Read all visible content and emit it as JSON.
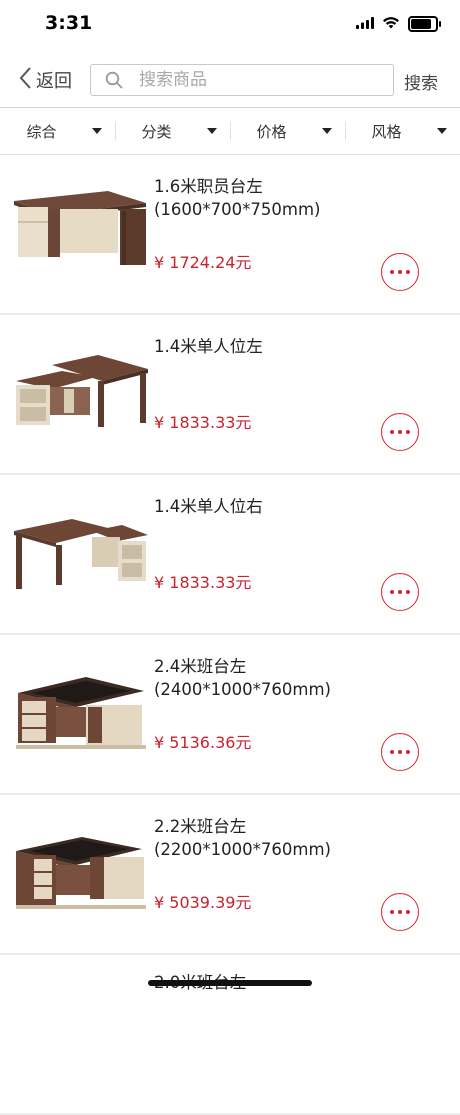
{
  "status_bar": {
    "time": "3:31"
  },
  "nav": {
    "back_label": "返回",
    "search_placeholder": "搜索商品",
    "search_button": "搜索"
  },
  "filters": [
    {
      "label": "综合"
    },
    {
      "label": "分类"
    },
    {
      "label": "价格"
    },
    {
      "label": "风格"
    }
  ],
  "products": [
    {
      "title": "1.6米职员台左\n(1600*700*750mm)",
      "price": "¥ 1724.24元"
    },
    {
      "title": "1.4米单人位左",
      "price": "¥ 1833.33元"
    },
    {
      "title": "1.4米单人位右",
      "price": "¥ 1833.33元"
    },
    {
      "title": "2.4米班台左\n(2400*1000*760mm)",
      "price": "¥ 5136.36元"
    },
    {
      "title": "2.2米班台左\n(2200*1000*760mm)",
      "price": "¥ 5039.39元"
    },
    {
      "title": "2.0米班台左",
      "price": ""
    }
  ],
  "colors": {
    "accent": "#d8262e",
    "price": "#c8242c"
  }
}
